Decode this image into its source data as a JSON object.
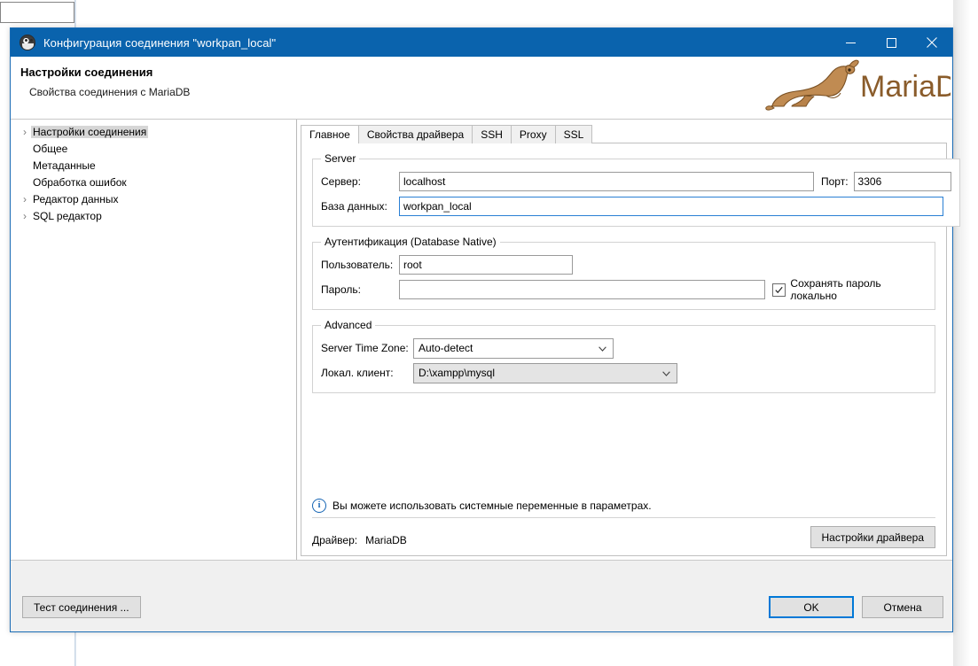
{
  "background": {
    "toolbar_field_value": ""
  },
  "window": {
    "title": "Конфигурация соединения \"workpan_local\"",
    "icon": "dbeaver-app-icon",
    "controls": {
      "minimize": "minimize-icon",
      "maximize": "maximize-icon",
      "close": "close-icon"
    },
    "titlebar_color": "#0a63ad"
  },
  "header": {
    "title": "Настройки соединения",
    "subtitle": "Свойства соединения с MariaDB",
    "logo_text": "MariaDB",
    "logo_color": "#8a5c2b"
  },
  "tree": {
    "items": [
      {
        "label": "Настройки соединения",
        "expandable": true,
        "selected": true
      },
      {
        "label": "Общее",
        "expandable": false,
        "selected": false
      },
      {
        "label": "Метаданные",
        "expandable": false,
        "selected": false
      },
      {
        "label": "Обработка ошибок",
        "expandable": false,
        "selected": false
      },
      {
        "label": "Редактор данных",
        "expandable": true,
        "selected": false
      },
      {
        "label": "SQL редактор",
        "expandable": true,
        "selected": false
      }
    ]
  },
  "tabs": [
    {
      "label": "Главное",
      "active": true
    },
    {
      "label": "Свойства драйвера",
      "active": false
    },
    {
      "label": "SSH",
      "active": false
    },
    {
      "label": "Proxy",
      "active": false
    },
    {
      "label": "SSL",
      "active": false
    }
  ],
  "server_group": {
    "legend": "Server",
    "host_label": "Сервер:",
    "host_value": "localhost",
    "port_label": "Порт:",
    "port_value": "3306",
    "database_label": "База данных:",
    "database_value": "workpan_local",
    "database_focused": true
  },
  "auth_group": {
    "legend": "Аутентификация (Database Native)",
    "user_label": "Пользователь:",
    "user_value": "root",
    "password_label": "Пароль:",
    "password_value": "",
    "save_password_label": "Сохранять пароль локально",
    "save_password_checked": true
  },
  "advanced_group": {
    "legend": "Advanced",
    "timezone_label": "Server Time Zone:",
    "timezone_value": "Auto-detect",
    "local_client_label": "Локал. клиент:",
    "local_client_value": "D:\\xampp\\mysql"
  },
  "info": {
    "icon": "info-icon",
    "text": "Вы можете использовать системные переменные в параметрах."
  },
  "driver": {
    "label": "Драйвер:",
    "value": "MariaDB",
    "settings_button": "Настройки драйвера"
  },
  "footer": {
    "test_button": "Тест соединения ...",
    "ok_button": "OK",
    "cancel_button": "Отмена",
    "ok_focus_color": "#0078d7"
  }
}
